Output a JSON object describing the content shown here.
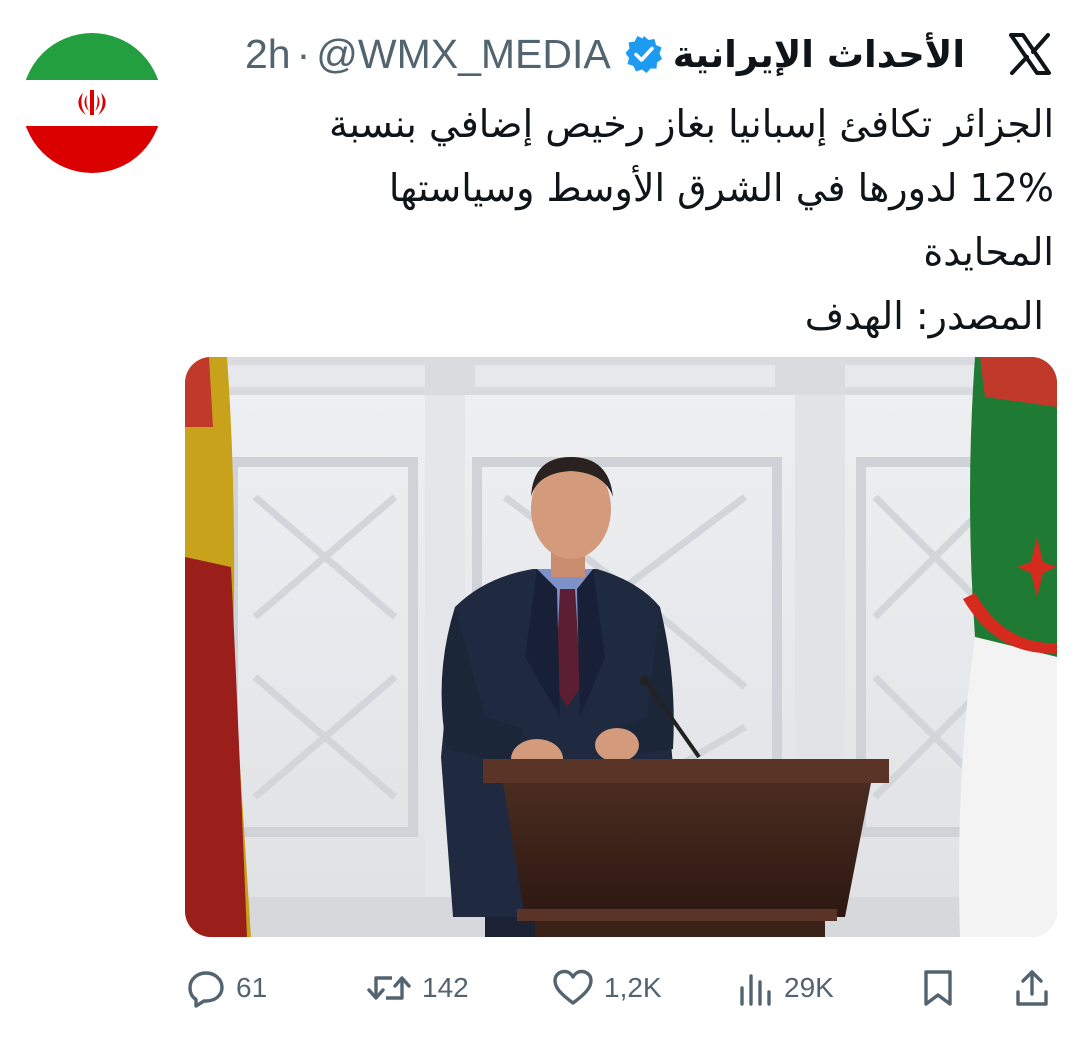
{
  "tweet": {
    "display_name": "الأحداث الإيرانية",
    "handle": "@WMX_MEDIA",
    "separator": "·",
    "time": "2h",
    "text_lines": [
      "الجزائر تكافئ إسبانيا بغاز رخيص إضافي بنسبة",
      "12% لدورها في الشرق الأوسط وسياستها",
      "المحايدة",
      "المصدر: الهدف"
    ]
  },
  "actions": {
    "replies": "61",
    "reposts": "142",
    "likes": "1,2K",
    "views": "29K"
  },
  "icons": {
    "avatar": "iran-flag-avatar",
    "verified": "verified-badge-icon",
    "platform": "x-logo-icon",
    "reply": "reply-icon",
    "repost": "repost-icon",
    "like": "heart-icon",
    "views": "views-icon",
    "bookmark": "bookmark-icon",
    "share": "share-icon"
  },
  "colors": {
    "text": "#0f1419",
    "secondary": "#536471",
    "verified_blue": "#1d9bf0",
    "iran_green": "#239f40",
    "iran_red": "#da0000"
  }
}
